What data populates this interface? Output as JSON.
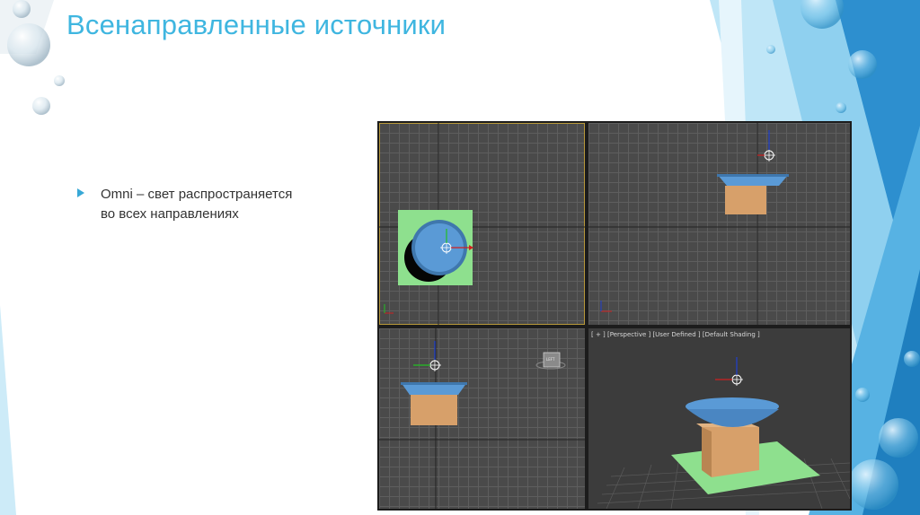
{
  "slide": {
    "title": "Всенаправленные источники",
    "bullet": {
      "line1": "Omni – свет распространяется",
      "line2": "во всех направлениях"
    }
  },
  "viewports": {
    "perspective_label": "[ + ] [Perspective ] [User Defined ] [Default Shading ]",
    "left_navcube_label": "LEFT"
  },
  "colors": {
    "title": "#3fb6e0",
    "bullet": "#37a8d6",
    "bowl": "#5a9ad6",
    "box": "#d7a06a",
    "plane": "#8ee08e",
    "grid_bg": "#4a4a4a",
    "active_viewport_border": "#b7983a"
  },
  "icons": [
    "bullet-arrow-icon",
    "omni-light-icon",
    "axis-gizmo-icon",
    "water-drop-icon"
  ]
}
